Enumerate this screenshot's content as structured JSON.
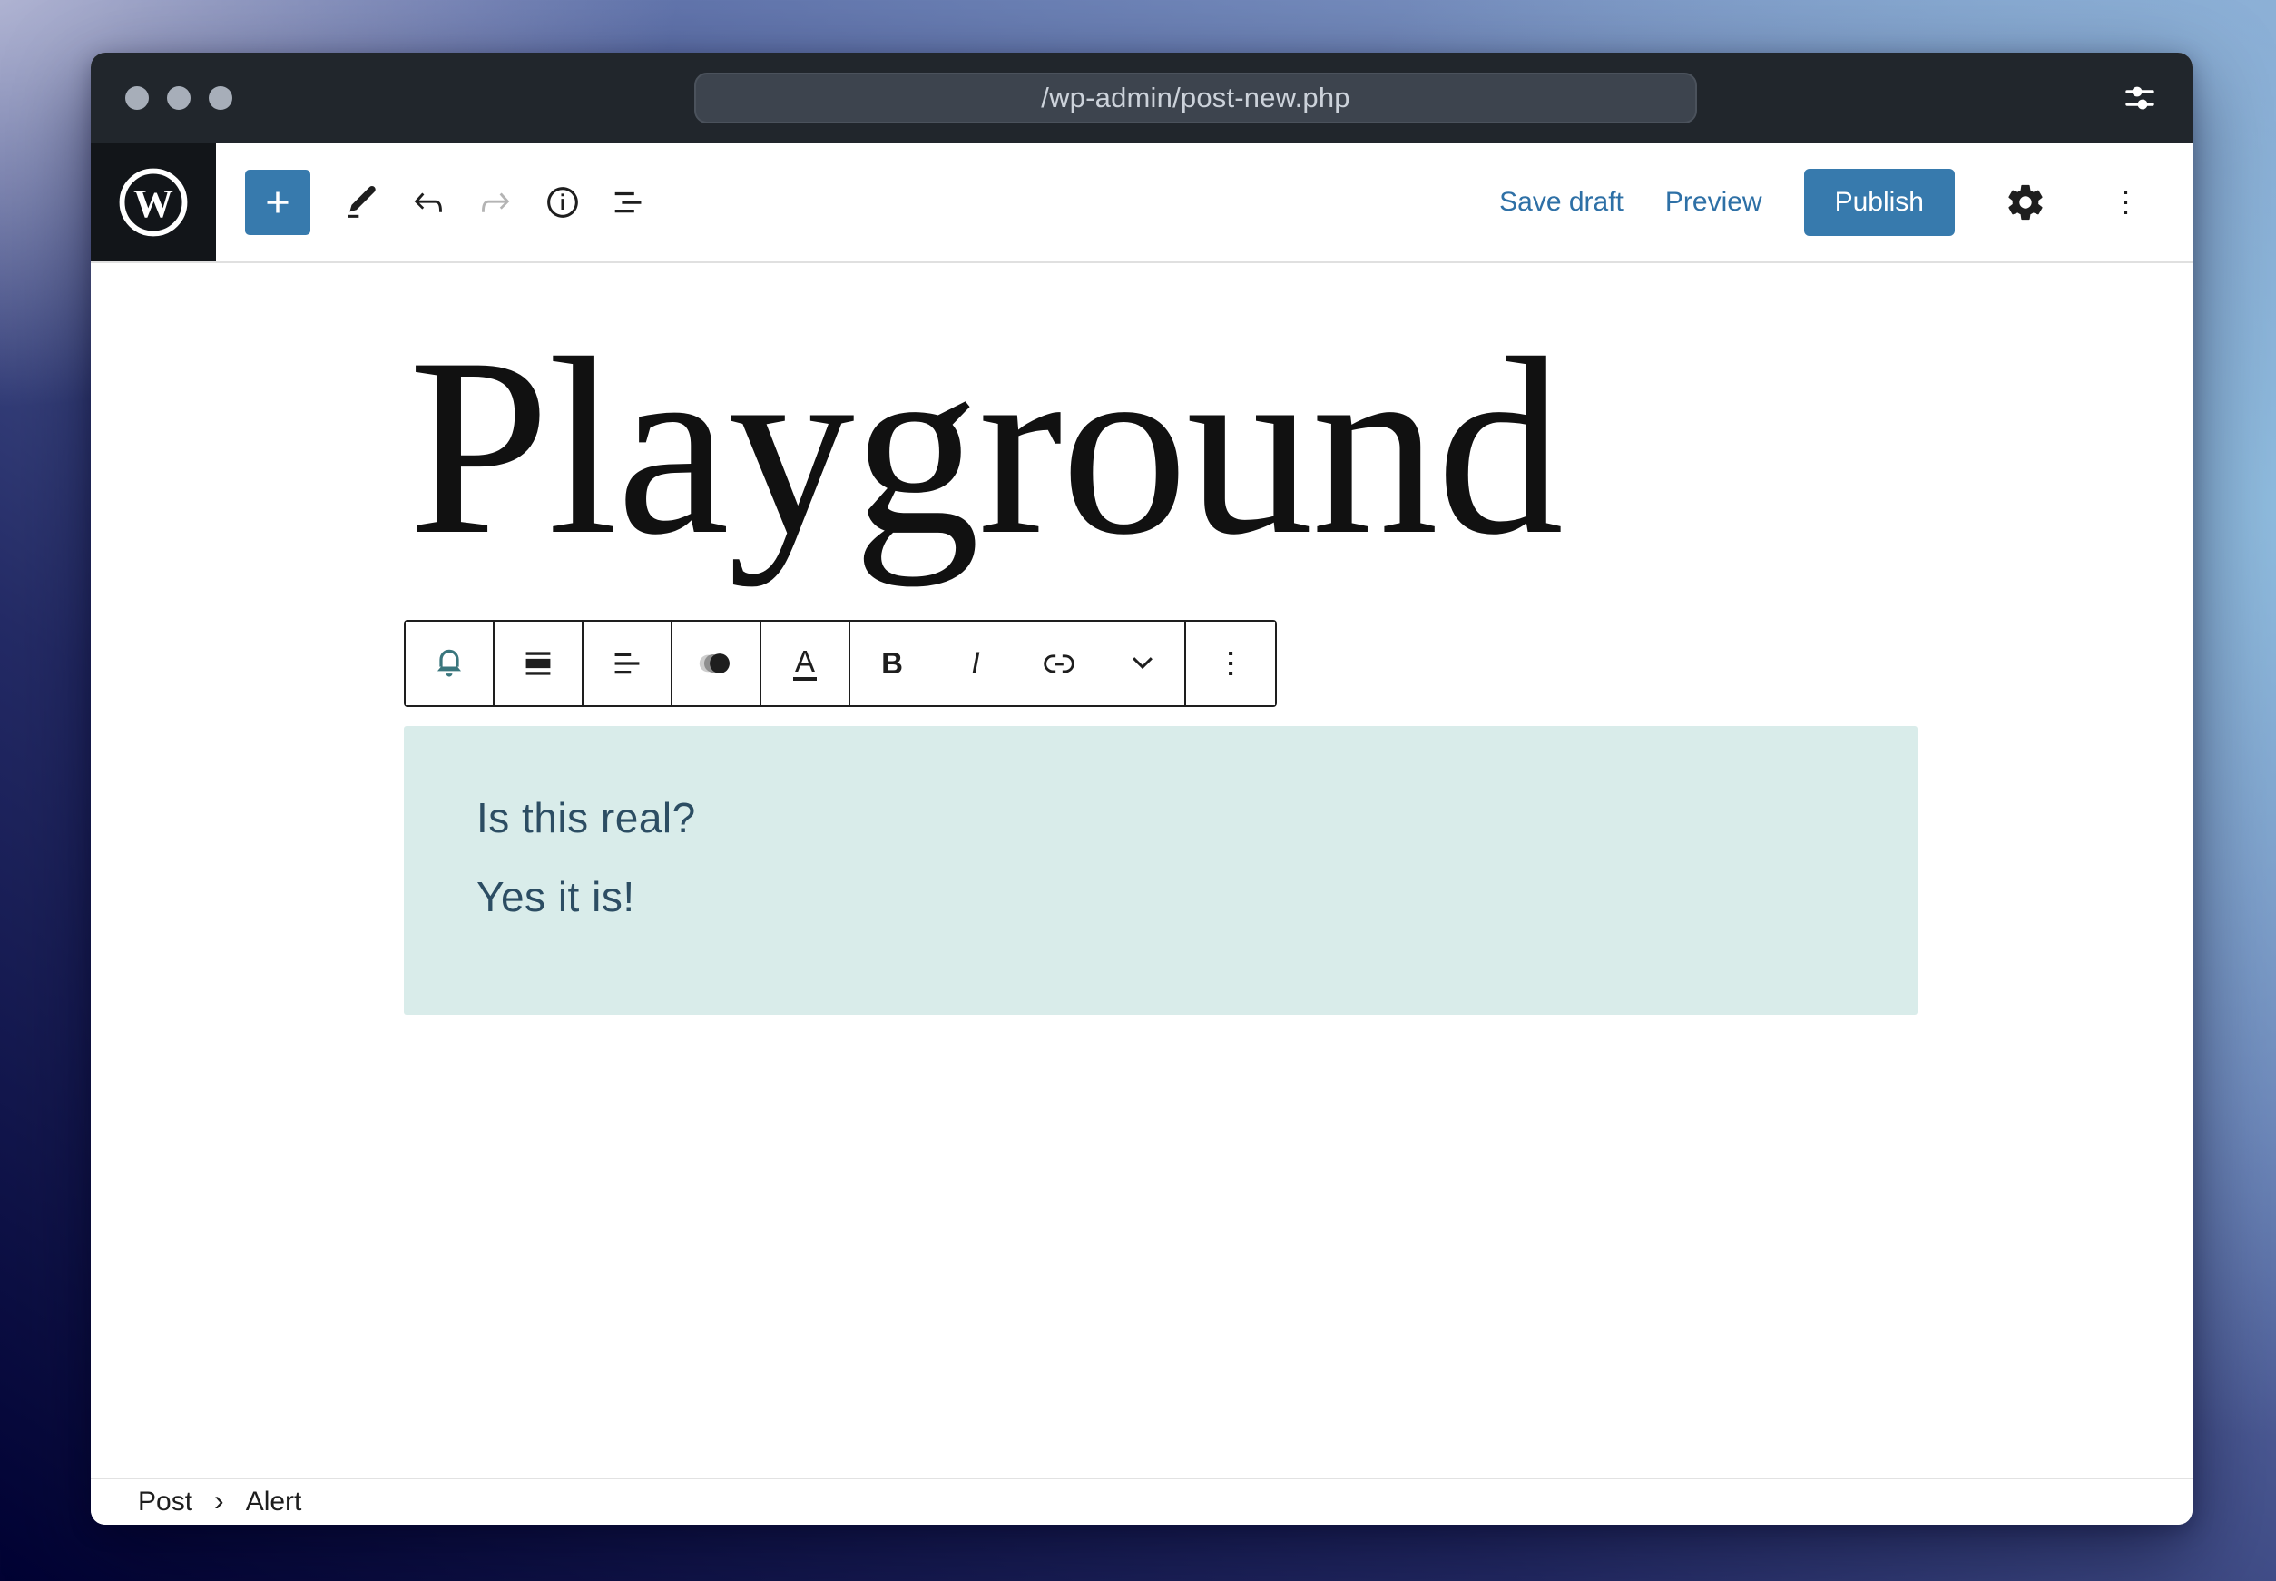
{
  "titlebar": {
    "url": "/wp-admin/post-new.php"
  },
  "editor_header": {
    "save_draft_label": "Save draft",
    "preview_label": "Preview",
    "publish_label": "Publish"
  },
  "post": {
    "title": "Playground"
  },
  "block_toolbar": {
    "highlight_label": "A",
    "bold_label": "B",
    "italic_label": "I"
  },
  "alert_block": {
    "paragraphs": [
      "Is this real?",
      "Yes it is!"
    ]
  },
  "breadcrumb": {
    "post_label": "Post",
    "separator": "›",
    "block_label": "Alert"
  },
  "colors": {
    "accent_blue": "#377aad",
    "link_blue": "#2e70a6",
    "bell_teal": "#3a767d",
    "alert_background": "#d9ecea",
    "alert_text": "#2c4d63",
    "titlebar_background": "#21262c"
  }
}
